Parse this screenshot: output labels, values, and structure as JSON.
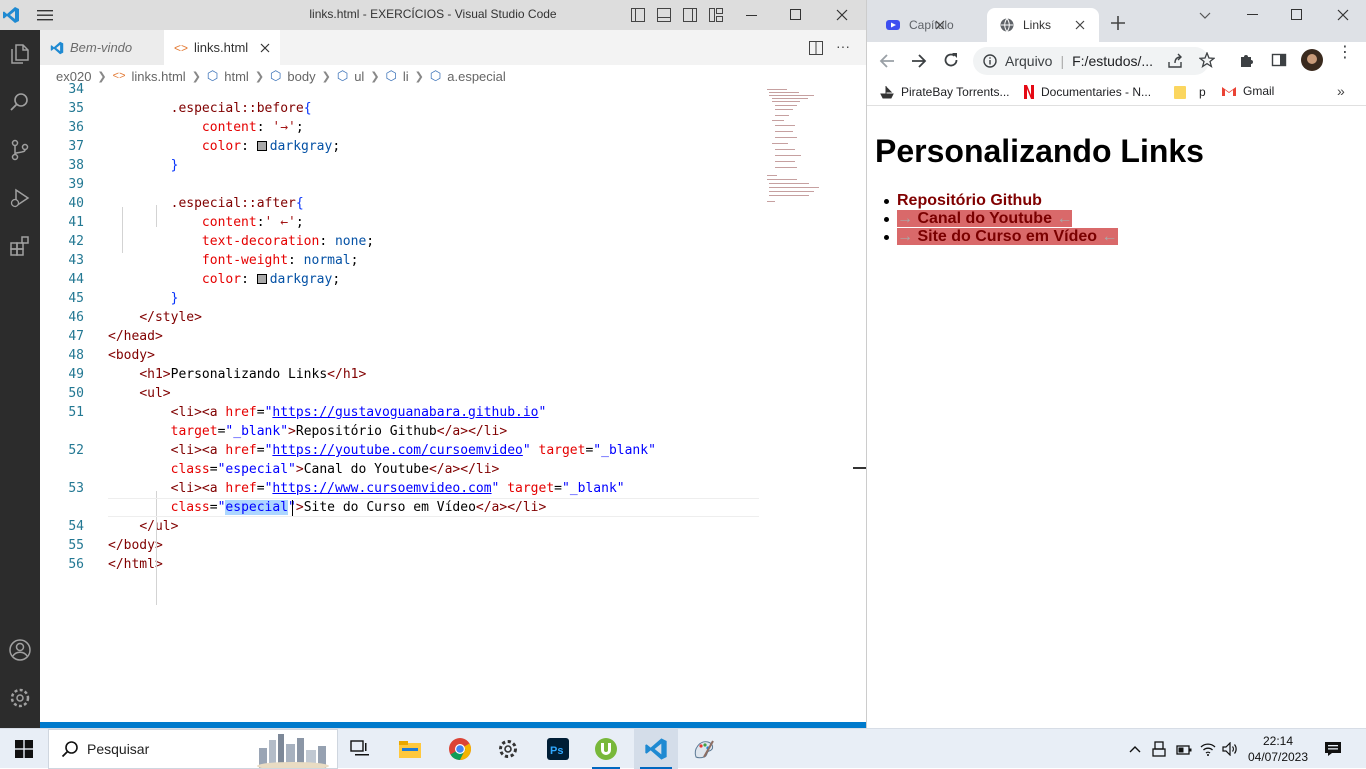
{
  "vscode": {
    "title": "links.html - EXERCÍCIOS - Visual Studio Code",
    "tabs": [
      {
        "label": "Bem-vindo"
      },
      {
        "label": "links.html"
      }
    ],
    "breadcrumb": [
      "ex020",
      "links.html",
      "html",
      "body",
      "ul",
      "li",
      "a.especial"
    ],
    "lines": [
      {
        "n": "34",
        "html": ""
      },
      {
        "n": "35",
        "html": "        <span class='t-sel'>.especial::before</span><span class='t-brace'>{</span>"
      },
      {
        "n": "36",
        "html": "            <span class='t-prop'>content</span>: <span class='t-val' style='color:#a31515'>'→'</span>;"
      },
      {
        "n": "37",
        "html": "            <span class='t-prop'>color</span>: <span class='swatch'></span><span class='t-val'>darkgray</span>;"
      },
      {
        "n": "38",
        "html": "        <span class='t-brace'>}</span>"
      },
      {
        "n": "39",
        "html": ""
      },
      {
        "n": "40",
        "html": "        <span class='t-sel'>.especial::after</span><span class='t-brace'>{</span>"
      },
      {
        "n": "41",
        "html": "            <span class='t-prop'>content</span>:<span style='color:#a31515'>' ←'</span>;"
      },
      {
        "n": "42",
        "html": "            <span class='t-prop'>text-decoration</span>: <span class='t-val'>none</span>;"
      },
      {
        "n": "43",
        "html": "            <span class='t-prop'>font-weight</span>: <span class='t-val'>normal</span>;"
      },
      {
        "n": "44",
        "html": "            <span class='t-prop'>color</span>: <span class='swatch'></span><span class='t-val'>darkgray</span>;"
      },
      {
        "n": "45",
        "html": "        <span class='t-brace'>}</span>"
      },
      {
        "n": "46",
        "html": "    <span class='t-tag'>&lt;/style&gt;</span>"
      },
      {
        "n": "47",
        "html": "<span class='t-tag'>&lt;/head&gt;</span>"
      },
      {
        "n": "48",
        "html": "<span class='t-tag'>&lt;body&gt;</span>"
      },
      {
        "n": "49",
        "html": "    <span class='t-tag'>&lt;h1&gt;</span>Personalizando Links<span class='t-tag'>&lt;/h1&gt;</span>"
      },
      {
        "n": "50",
        "html": "    <span class='t-tag'>&lt;ul&gt;</span>"
      },
      {
        "n": "51",
        "html": "        <span class='t-tag'>&lt;li&gt;&lt;a</span> <span class='t-attr'>href</span>=<span class='t-str'>\"<span class='t-link'>https://gustavoguanabara.github.io</span>\"</span>"
      },
      {
        "n": "",
        "html": "        <span class='t-attr'>target</span>=<span class='t-str'>\"_blank\"</span><span class='t-tag'>&gt;</span>Repositório Github<span class='t-tag'>&lt;/a&gt;&lt;/li&gt;</span>"
      },
      {
        "n": "52",
        "html": "        <span class='t-tag'>&lt;li&gt;&lt;a</span> <span class='t-attr'>href</span>=<span class='t-str'>\"<span class='t-link'>https://youtube.com/cursoemvideo</span>\"</span> <span class='t-attr'>target</span>=<span class='t-str'>\"_blank\"</span>"
      },
      {
        "n": "",
        "html": "        <span class='t-attr'>class</span>=<span class='t-str'>\"especial\"</span><span class='t-tag'>&gt;</span>Canal do Youtube<span class='t-tag'>&lt;/a&gt;&lt;/li&gt;</span>"
      },
      {
        "n": "53",
        "html": "        <span class='t-tag'>&lt;li&gt;&lt;a</span> <span class='t-attr'>href</span>=<span class='t-str'>\"<span class='t-link'>https://www.cursoemvideo.com</span>\"</span> <span class='t-attr'>target</span>=<span class='t-str'>\"_blank\"</span>"
      },
      {
        "n": "",
        "html": "        <span class='t-attr'>class</span>=<span class='t-str'>\"<span style='background:#add6ff'>especial</span>\"</span><span class='t-tag'>&gt;</span>Site do Curso em Vídeo<span class='t-tag'>&lt;/a&gt;&lt;/li&gt;</span>"
      },
      {
        "n": "54",
        "html": "    <span class='t-tag'>&lt;/ul&gt;</span>"
      },
      {
        "n": "55",
        "html": "<span class='t-tag'>&lt;/body&gt;</span>"
      },
      {
        "n": "56",
        "html": "<span class='t-tag'>&lt;/html&gt;</span>"
      }
    ]
  },
  "chrome": {
    "tabs": [
      {
        "label": "Capítulo"
      },
      {
        "label": "Links"
      }
    ],
    "omnibox": {
      "scheme": "Arquivo",
      "url": "F:/estudos/..."
    },
    "bookmarks": [
      {
        "label": "PirateBay Torrents..."
      },
      {
        "label": "Documentaries - N..."
      },
      {
        "label": "p"
      },
      {
        "label": "Gmail"
      }
    ],
    "page": {
      "h1": "Personalizando Links",
      "items": [
        {
          "text": "Repositório Github",
          "special": false
        },
        {
          "text": "Canal do Youtube",
          "special": true
        },
        {
          "text": "Site do Curso em Vídeo",
          "special": true
        }
      ],
      "before_glyph": "→",
      "after_glyph": "←"
    }
  },
  "taskbar": {
    "search_placeholder": "Pesquisar",
    "time": "22:14",
    "date": "04/07/2023"
  }
}
